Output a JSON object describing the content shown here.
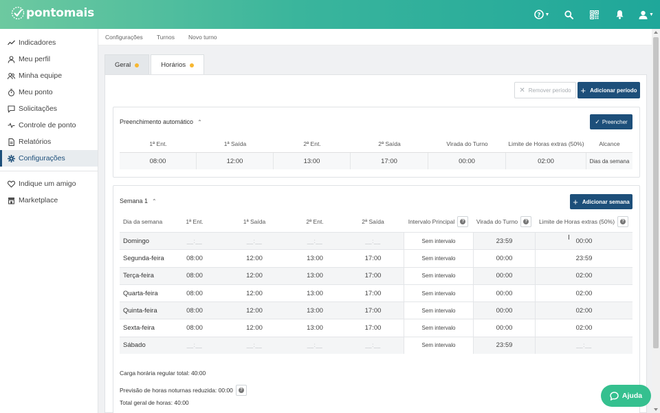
{
  "brand": {
    "name": "pontomais",
    "accent": "#1d4f7a",
    "gradient_start": "#6dc9a0",
    "gradient_end": "#1fa79a"
  },
  "topbar": {
    "icons": [
      "help-icon",
      "search-icon",
      "qrcode-icon",
      "bell-icon",
      "user-icon"
    ]
  },
  "sidebar": {
    "items": [
      {
        "label": "Indicadores",
        "icon": "chart-line-icon"
      },
      {
        "label": "Meu perfil",
        "icon": "user-icon"
      },
      {
        "label": "Minha equipe",
        "icon": "users-icon"
      },
      {
        "label": "Meu ponto",
        "icon": "stopwatch-icon"
      },
      {
        "label": "Solicitações",
        "icon": "chat-icon"
      },
      {
        "label": "Controle de ponto",
        "icon": "activity-icon"
      },
      {
        "label": "Relatórios",
        "icon": "document-icon"
      },
      {
        "label": "Configurações",
        "icon": "gear-icon"
      }
    ],
    "extra": [
      {
        "label": "Indique um amigo",
        "icon": "heart-icon"
      },
      {
        "label": "Marketplace",
        "icon": "store-icon"
      }
    ],
    "active": "Configurações"
  },
  "breadcrumb": [
    "Configurações",
    "Turnos",
    "Novo turno"
  ],
  "tabs": [
    {
      "label": "Geral"
    },
    {
      "label": "Horários"
    }
  ],
  "actions": {
    "remove_period": "Remover período",
    "add_period": "Adicionar período"
  },
  "auto_fill": {
    "title": "Preenchimento automático",
    "fill_button": "Preencher",
    "headers": [
      "1ª Ent.",
      "1ª Saída",
      "2ª Ent.",
      "2ª Saída",
      "Virada do Turno",
      "Limite de Horas extras (50%)",
      "Alcance"
    ],
    "values": [
      "08:00",
      "12:00",
      "13:00",
      "17:00",
      "00:00",
      "02:00",
      "Dias da semana"
    ]
  },
  "week": {
    "title": "Semana 1",
    "add_week_button": "Adicionar semana",
    "headers": [
      "Dia da semana",
      "1ª Ent.",
      "1ª Saída",
      "2ª Ent.",
      "2ª Saída",
      "Intervalo Principal",
      "Virada do Turno",
      "Limite de Horas extras (50%)"
    ],
    "rows": [
      {
        "day": "Domingo",
        "e1": "__:__",
        "s1": "__:__",
        "e2": "__:__",
        "s2": "__:__",
        "interval": "Sem intervalo",
        "virada": "23:59",
        "limite": "00:00"
      },
      {
        "day": "Segunda-feira",
        "e1": "08:00",
        "s1": "12:00",
        "e2": "13:00",
        "s2": "17:00",
        "interval": "Sem intervalo",
        "virada": "00:00",
        "limite": "23:59"
      },
      {
        "day": "Terça-feira",
        "e1": "08:00",
        "s1": "12:00",
        "e2": "13:00",
        "s2": "17:00",
        "interval": "Sem intervalo",
        "virada": "00:00",
        "limite": "02:00"
      },
      {
        "day": "Quarta-feira",
        "e1": "08:00",
        "s1": "12:00",
        "e2": "13:00",
        "s2": "17:00",
        "interval": "Sem intervalo",
        "virada": "00:00",
        "limite": "02:00"
      },
      {
        "day": "Quinta-feira",
        "e1": "08:00",
        "s1": "12:00",
        "e2": "13:00",
        "s2": "17:00",
        "interval": "Sem intervalo",
        "virada": "00:00",
        "limite": "02:00"
      },
      {
        "day": "Sexta-feira",
        "e1": "08:00",
        "s1": "12:00",
        "e2": "13:00",
        "s2": "17:00",
        "interval": "Sem intervalo",
        "virada": "00:00",
        "limite": "02:00"
      },
      {
        "day": "Sábado",
        "e1": "__:__",
        "s1": "__:__",
        "e2": "__:__",
        "s2": "__:__",
        "interval": "Sem intervalo",
        "virada": "23:59",
        "limite": "__:__"
      }
    ],
    "summary": {
      "carga": "Carga horária regular total: 40:00",
      "previsao": "Previsão de horas noturnas reduzida: 00:00",
      "total": "Total geral de horas: 40:00"
    }
  },
  "help_button": "Ajuda"
}
